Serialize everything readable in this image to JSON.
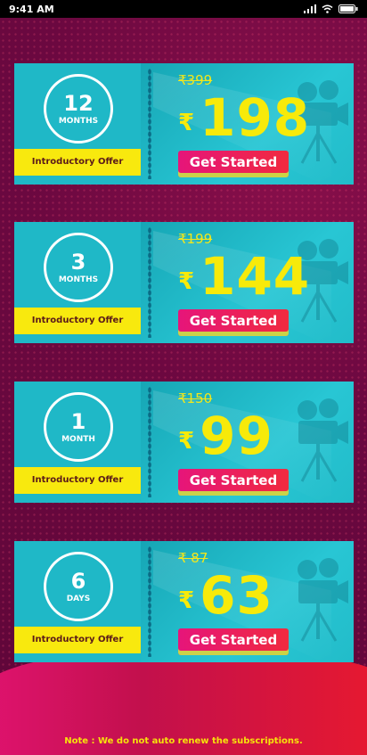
{
  "status_bar": {
    "time": "9:41 AM"
  },
  "plans": [
    {
      "number": "12",
      "unit": "MONTHS",
      "offer": "Introductory Offer",
      "old_price": "₹399",
      "currency": "₹",
      "price": "198",
      "button": "Get Started"
    },
    {
      "number": "3",
      "unit": "MONTHS",
      "offer": "Introductory Offer",
      "old_price": "₹199",
      "currency": "₹",
      "price": "144",
      "button": "Get Started"
    },
    {
      "number": "1",
      "unit": "MONTH",
      "offer": "Introductory Offer",
      "old_price": "₹150",
      "currency": "₹",
      "price": "99",
      "button": "Get Started"
    },
    {
      "number": "6",
      "unit": "DAYS",
      "offer": "Introductory Offer",
      "old_price": "₹ 87",
      "currency": "₹",
      "price": "63",
      "button": "Get Started"
    }
  ],
  "footer": {
    "note": "Note : We do not auto renew the subscriptions."
  },
  "colors": {
    "background": "#6b0840",
    "card_teal": "#1ab3c2",
    "price_yellow": "#f7ea0a",
    "ribbon_yellow": "#f8e90e",
    "button_gradient_start": "#e6157a",
    "button_gradient_end": "#f02a3f"
  },
  "icons": [
    "signal-icon",
    "wifi-icon",
    "battery-icon",
    "film-camera-icon"
  ]
}
